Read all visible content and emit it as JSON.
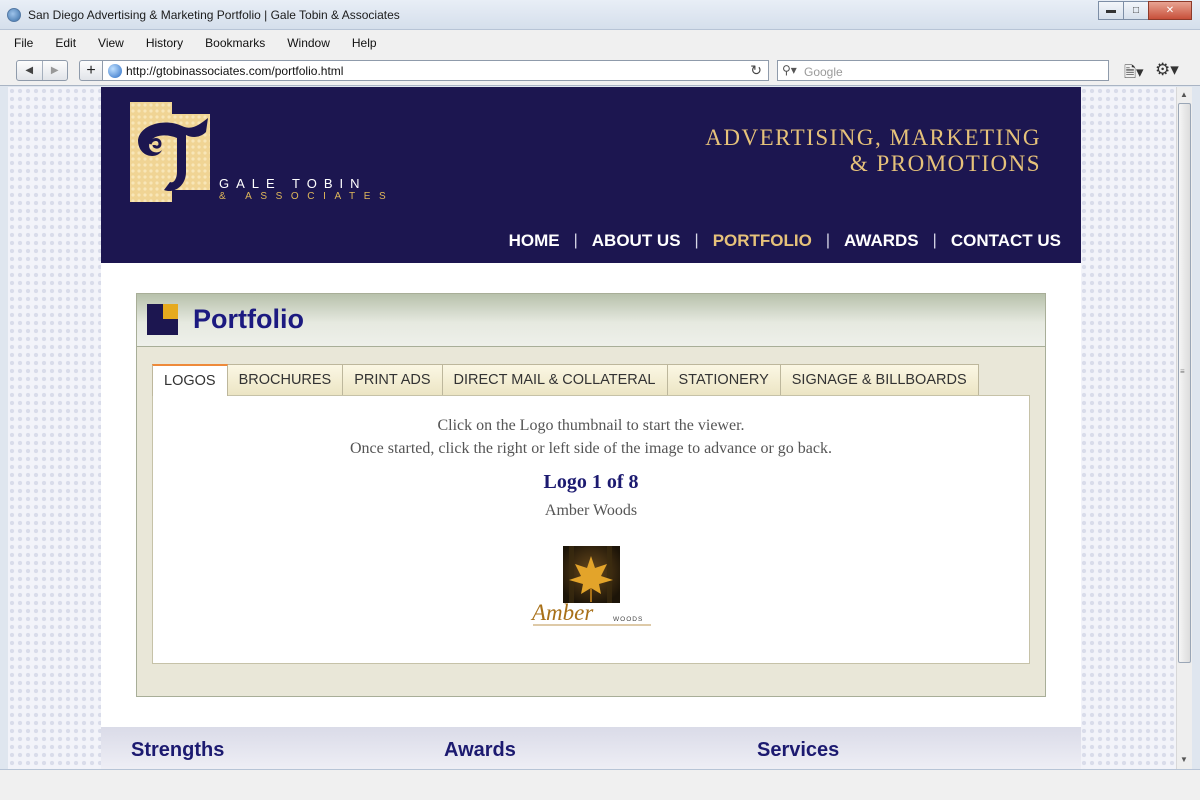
{
  "browser": {
    "window_title": "San Diego Advertising & Marketing Portfolio | Gale Tobin & Associates",
    "menu": [
      "File",
      "Edit",
      "View",
      "History",
      "Bookmarks",
      "Window",
      "Help"
    ],
    "url": "http://gtobinassociates.com/portfolio.html",
    "search_placeholder": "Google"
  },
  "site": {
    "logo_name": "GALE TOBIN",
    "logo_sub": "& ASSOCIATES",
    "tagline_line1": "ADVERTISING, MARKETING",
    "tagline_line2": "& PROMOTIONS",
    "nav": {
      "home": "HOME",
      "about": "ABOUT US",
      "portfolio": "PORTFOLIO",
      "awards": "AWARDS",
      "contact": "CONTACT US",
      "active": "PORTFOLIO"
    },
    "colors": {
      "navy": "#1c1650",
      "gold": "#e6c27a",
      "accent": "#e6aa1f"
    }
  },
  "portfolio": {
    "title": "Portfolio",
    "tabs": {
      "logos": "LOGOS",
      "brochures": "BROCHURES",
      "print_ads": "PRINT ADS",
      "direct_mail": "DIRECT MAIL & COLLATERAL",
      "stationery": "STATIONERY",
      "signage": "SIGNAGE & BILLBOARDS",
      "active": "LOGOS"
    },
    "instruction_line1": "Click on the Logo thumbnail to start the viewer.",
    "instruction_line2": "Once started, click the right or left side of the image to advance or go back.",
    "counter": "Logo 1 of 8",
    "client": "Amber Woods",
    "thumb_text_main": "Amber",
    "thumb_text_sub": "WOODS"
  },
  "footer": {
    "col1": "Strengths",
    "col2": "Awards",
    "col3": "Services"
  }
}
